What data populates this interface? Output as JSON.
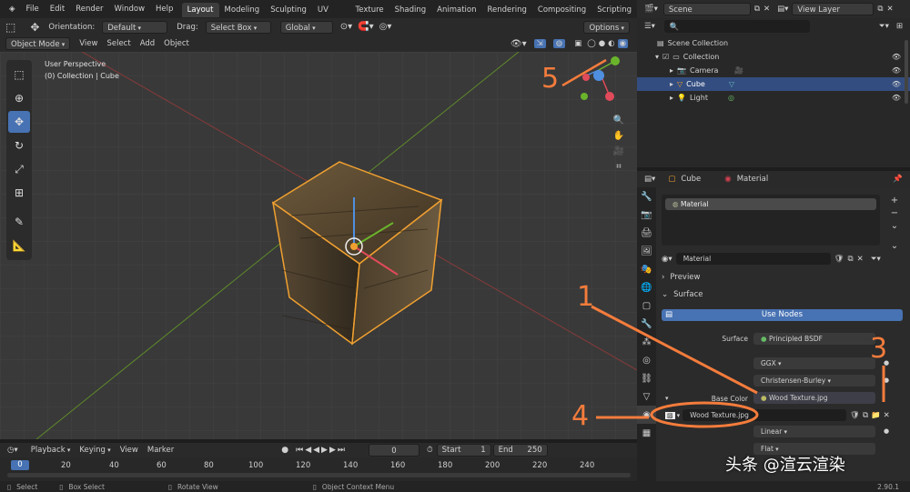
{
  "menu": {
    "items": [
      "File",
      "Edit",
      "Render",
      "Window",
      "Help"
    ]
  },
  "workspaces": [
    "Layout",
    "Modeling",
    "Sculpting",
    "UV Editing",
    "Texture Paint",
    "Shading",
    "Animation",
    "Rendering",
    "Compositing",
    "Scripting"
  ],
  "active_workspace": "Layout",
  "header": {
    "orientation_label": "Orientation:",
    "orientation_value": "Default",
    "drag_label": "Drag:",
    "drag_value": "Select Box",
    "transform_value": "Global",
    "options": "Options"
  },
  "header2": {
    "mode": "Object Mode",
    "view": "View",
    "select": "Select",
    "add": "Add",
    "object": "Object"
  },
  "viewport": {
    "line1": "User Perspective",
    "line2": "(0) Collection | Cube"
  },
  "timeline": {
    "playback": "Playback",
    "keying": "Keying",
    "view": "View",
    "marker": "Marker",
    "current": "0",
    "start_label": "Start",
    "start": "1",
    "end_label": "End",
    "end": "250",
    "ticks": [
      "0",
      "20",
      "40",
      "60",
      "80",
      "100",
      "120",
      "140",
      "160",
      "180",
      "200",
      "220",
      "240"
    ]
  },
  "status": {
    "select": "Select",
    "box": "Box Select",
    "rotate": "Rotate View",
    "context": "Object Context Menu",
    "version": "2.90.1"
  },
  "outliner": {
    "scene": "Scene",
    "view_layer": "View Layer",
    "items": [
      {
        "name": "Scene Collection",
        "indent": 0
      },
      {
        "name": "Collection",
        "indent": 1
      },
      {
        "name": "Camera",
        "indent": 2
      },
      {
        "name": "Cube",
        "indent": 2
      },
      {
        "name": "Light",
        "indent": 2
      }
    ]
  },
  "properties": {
    "object": "Cube",
    "material_tab": "Material",
    "slot": "Material",
    "mat_name": "Material",
    "preview": "Preview",
    "surface_section": "Surface",
    "use_nodes": "Use Nodes",
    "surface_label": "Surface",
    "surface_value": "Principled BSDF",
    "distribution": "GGX",
    "subsurface": "Christensen-Burley",
    "base_color_label": "Base Color",
    "base_color_value": "Wood Texture.jpg",
    "image_name": "Wood Texture.jpg",
    "interpolation": "Linear",
    "projection": "Flat"
  },
  "annotations": [
    "1",
    "3",
    "4",
    "5"
  ],
  "watermark": "头条 @渲云渲染",
  "colors": {
    "accent": "#4772b3",
    "selected": "#f0a030",
    "annotation": "#f47c3c"
  }
}
